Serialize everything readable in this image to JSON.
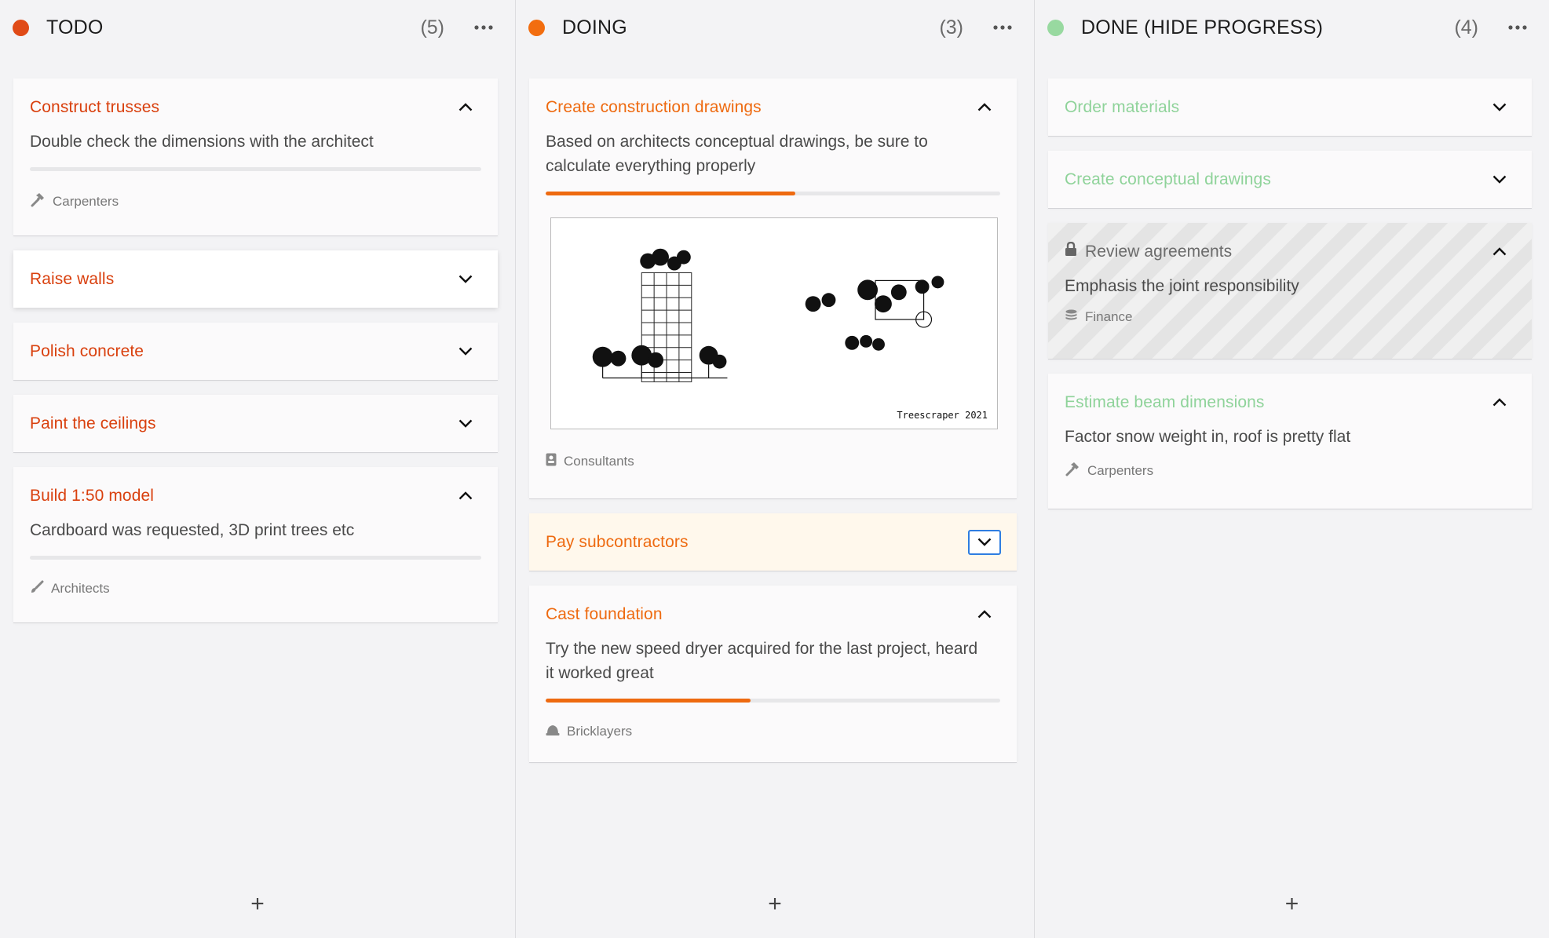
{
  "columns": [
    {
      "title": "TODO",
      "count": "(5)",
      "dot_color": "#e04a16",
      "title_color": "#d9400e",
      "cards": [
        {
          "title": "Construct trusses",
          "expanded": true,
          "desc": "Double check the dimensions with the architect",
          "progress": 0,
          "tag": "Carpenters",
          "tag_icon": "hammer-icon"
        },
        {
          "title": "Raise walls",
          "expanded": false
        },
        {
          "title": "Polish concrete",
          "expanded": false
        },
        {
          "title": "Paint the ceilings",
          "expanded": false
        },
        {
          "title": "Build 1:50 model",
          "expanded": true,
          "desc": "Cardboard was requested, 3D print trees etc",
          "progress": 0,
          "tag": "Architects",
          "tag_icon": "brush-icon"
        }
      ]
    },
    {
      "title": "DOING",
      "count": "(3)",
      "dot_color": "#f26d0f",
      "title_color": "#ee6a10",
      "cards": [
        {
          "title": "Create construction drawings",
          "expanded": true,
          "desc": "Based on architects conceptual drawings, be sure to calculate everything properly",
          "progress": 0.55,
          "image_caption": "Treescraper 2021",
          "tag": "Consultants",
          "tag_icon": "badge-icon"
        },
        {
          "title": "Pay subcontractors",
          "expanded": false
        },
        {
          "title": "Cast foundation",
          "expanded": true,
          "desc": "Try the new speed dryer acquired for the last project, heard it worked great",
          "progress": 0.45,
          "tag": "Bricklayers",
          "tag_icon": "helmet-icon"
        }
      ]
    },
    {
      "title": "DONE (HIDE PROGRESS)",
      "count": "(4)",
      "dot_color": "#98d9a0",
      "title_color": "#8fd39a",
      "cards": [
        {
          "title": "Order materials",
          "expanded": false
        },
        {
          "title": "Create conceptual drawings",
          "expanded": false
        },
        {
          "title": "Review agreements",
          "expanded": true,
          "locked": true,
          "desc": "Emphasis the joint responsibility",
          "tag": "Finance",
          "tag_icon": "coins-icon"
        },
        {
          "title": "Estimate beam dimensions",
          "expanded": true,
          "desc": "Factor snow weight in, roof is pretty flat",
          "tag": "Carpenters",
          "tag_icon": "hammer-icon"
        }
      ]
    }
  ],
  "add_label": "+"
}
